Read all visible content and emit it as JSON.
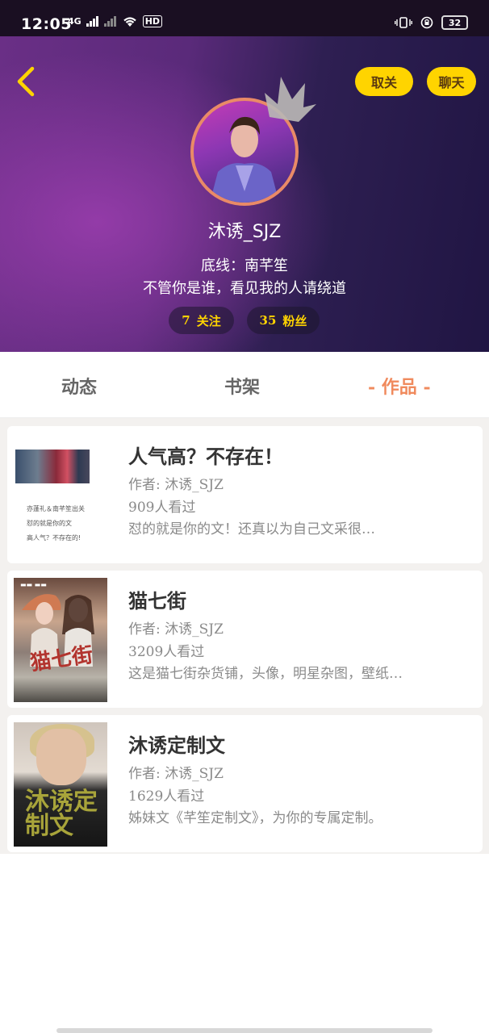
{
  "status_bar": {
    "time": "12:05",
    "network_label": "4G",
    "hd_label": "HD",
    "battery": "32"
  },
  "header": {
    "unfollow_label": "取关",
    "chat_label": "聊天",
    "username": "沐诱_SJZ",
    "bio_line1": "底线：南芊笙",
    "bio_line2": "不管你是谁，看见我的人请绕道",
    "following_count": "7",
    "following_label": "关注",
    "fans_count": "35",
    "fans_label": "粉丝",
    "accent_color": "#ffd400"
  },
  "tabs": [
    {
      "label": "动态"
    },
    {
      "label": "书架"
    },
    {
      "label": "- 作品 -",
      "active": true
    }
  ],
  "works": [
    {
      "title": "人气高？不存在！",
      "author": "作者: 沐诱_SJZ",
      "views": "909人看过",
      "desc": "怼的就是你的文！还真以为自己文采很…",
      "cover_lines": [
        "亦蓬礼＆南芊笙出关",
        "怼的就是你的文",
        "高人气？不存在的!"
      ]
    },
    {
      "title": "猫七街",
      "author": "作者: 沐诱_SJZ",
      "views": "3209人看过",
      "desc": "这是猫七街杂货铺，头像，明星杂图，壁纸…",
      "cover_title": "猫七街"
    },
    {
      "title": "沐诱定制文",
      "author": "作者: 沐诱_SJZ",
      "views": "1629人看过",
      "desc": "姊妹文《芊笙定制文》，为你的专属定制。",
      "cover_title": "沐诱定制文"
    }
  ]
}
